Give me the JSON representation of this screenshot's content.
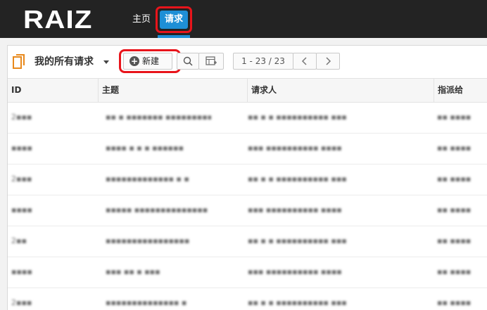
{
  "topbar": {
    "logo": "RAIZ",
    "nav": {
      "home": "主页",
      "requests": "请求"
    }
  },
  "toolbar": {
    "view_title": "我的所有请求",
    "new_button": "新建",
    "pagination": "1 - 23 / 23"
  },
  "table": {
    "headers": {
      "id": "ID",
      "subject": "主题",
      "requester": "请求人",
      "assignee": "指派给"
    },
    "rows": [
      {
        "id": "2▪▪▪",
        "subject": "▪▪ ▪ ▪▪▪▪▪▪▪ ▪▪▪▪▪▪▪▪▪▪",
        "requester": "▪▪ ▪ ▪ ▪▪▪▪▪▪▪▪▪▪ ▪▪▪",
        "assignee": "▪▪ ▪▪▪▪"
      },
      {
        "id": "▪▪▪▪",
        "subject": "▪▪▪▪ ▪ ▪ ▪ ▪▪▪▪▪▪",
        "requester": "▪▪▪ ▪▪▪▪▪▪▪▪▪▪ ▪▪▪▪",
        "assignee": "▪▪ ▪▪▪▪"
      },
      {
        "id": "2▪▪▪",
        "subject": "▪▪▪▪▪▪▪▪▪▪▪▪▪ ▪ ▪",
        "requester": "▪▪ ▪ ▪ ▪▪▪▪▪▪▪▪▪▪ ▪▪▪",
        "assignee": "▪▪ ▪▪▪▪"
      },
      {
        "id": "▪▪▪▪",
        "subject": "▪▪▪▪▪ ▪▪▪▪▪▪▪▪▪▪▪▪▪▪",
        "requester": "▪▪▪ ▪▪▪▪▪▪▪▪▪▪ ▪▪▪▪",
        "assignee": "▪▪ ▪▪▪▪"
      },
      {
        "id": "2▪▪",
        "subject": "▪▪▪▪▪▪▪▪▪▪▪▪▪▪▪▪",
        "requester": "▪▪ ▪ ▪ ▪▪▪▪▪▪▪▪▪▪ ▪▪▪",
        "assignee": "▪▪ ▪▪▪▪"
      },
      {
        "id": "▪▪▪▪",
        "subject": "▪▪▪ ▪▪ ▪ ▪▪▪",
        "requester": "▪▪▪ ▪▪▪▪▪▪▪▪▪▪ ▪▪▪▪",
        "assignee": "▪▪ ▪▪▪▪"
      },
      {
        "id": "2▪▪▪",
        "subject": "▪▪▪▪▪▪▪▪▪▪▪▪▪▪ ▪",
        "requester": "▪▪ ▪ ▪ ▪▪▪▪▪▪▪▪▪▪ ▪▪▪",
        "assignee": "▪▪ ▪▪▪▪"
      }
    ]
  },
  "colors": {
    "topbar": "#232323",
    "accent": "#1e8fd6",
    "highlight": "#e8141b"
  },
  "icons": [
    "document-icon",
    "caret-down-icon",
    "plus-circle-icon",
    "search-icon",
    "columns-icon",
    "chevron-left-icon",
    "chevron-right-icon"
  ]
}
